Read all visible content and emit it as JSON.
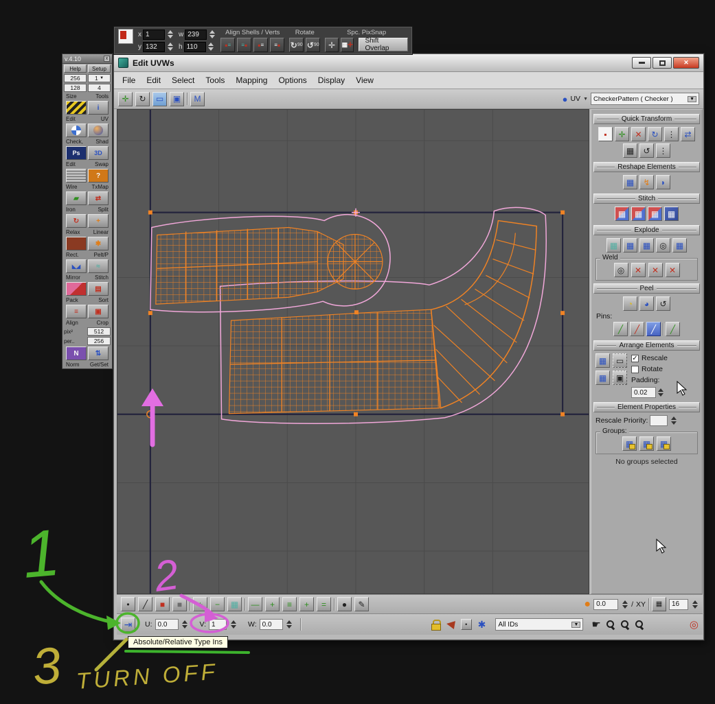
{
  "pixsnap": {
    "x_label": "x",
    "x_value": "1",
    "y_label": "y",
    "y_value": "132",
    "w_label": "w",
    "w_value": "239",
    "h_label": "h",
    "h_value": "110",
    "align_header": "Align Shells / Verts",
    "rotate_header": "Rotate",
    "spc_header": "Spc. PixSnap",
    "shift_overlap": "Shift Overlap",
    "deg": "90"
  },
  "textools": {
    "title": "v.4.10",
    "help": "Help",
    "setup": "Setup",
    "map_size": "256",
    "subdiv": "1",
    "map_size2": "128",
    "subdiv2": "4",
    "size_label": "Size",
    "tools_label": "Tools",
    "pix_label": "pix²",
    "pix_value": "512",
    "per_label": "per..",
    "per_value": "256",
    "caps": [
      "Edit",
      "UV",
      "Check,",
      "Shad",
      "Edit",
      "Swap",
      "Wire",
      "TxMap",
      "Iron",
      "Split",
      "Relax",
      "Linear",
      "Rect.",
      "Pelt/P",
      "Mirror",
      "Stitch",
      "Pack",
      "Sort",
      "Align",
      "Crop",
      "Norm",
      "Get/Set"
    ]
  },
  "window": {
    "title": "Edit UVWs",
    "menus": [
      "File",
      "Edit",
      "Select",
      "Tools",
      "Mapping",
      "Options",
      "Display",
      "View"
    ],
    "uv_label": "UV",
    "pattern": "CheckerPattern  ( Checker )"
  },
  "rightpanel": {
    "sections": [
      "Quick Transform",
      "Reshape Elements",
      "Stitch",
      "Explode",
      "Peel",
      "Arrange Elements",
      "Element Properties"
    ],
    "weld": "Weld",
    "pins": "Pins:",
    "rescale": "Rescale",
    "rotate": "Rotate",
    "rescale_check": "✓",
    "padding": "Padding:",
    "padding_value": "0.02",
    "rescale_priority": "Rescale Priority:",
    "groups": "Groups:",
    "no_groups": "No groups selected"
  },
  "bottom": {
    "u": "U:",
    "u_value": "0.0",
    "v": "V:",
    "v_value": "1",
    "w": "W:",
    "w_value": "0.0",
    "all_ids": "All IDs",
    "angle_value": "0.0",
    "slash": "/",
    "xy": "XY",
    "grid_value": "16"
  },
  "tooltip": {
    "text": "Absolute/Relative Type Ins"
  },
  "annotations": {
    "n1": "1",
    "n2": "2",
    "n3": "3",
    "turn_off": "TURN OFF"
  },
  "icons": {
    "close": "✕",
    "tt_close": "x",
    "drop": "▼",
    "move": "✛",
    "rotate": "↻",
    "marquee": "▭",
    "freeform": "▣",
    "mirror": "M",
    "sphere": "●",
    "dot": "•",
    "edge": "╱",
    "face": "■",
    "element": "■",
    "plus": "+",
    "minus": "−",
    "loop": "▦",
    "dash": "—",
    "lines": "≡",
    "eq": "=",
    "paint": "●",
    "pencil": "✎",
    "swatch": "●",
    "checker": "▦",
    "cross": "✕",
    "vdots": "⋮",
    "arrows": "⇄",
    "pivot": "▪",
    "target": "◎",
    "undo": "↺",
    "pie1": "◔",
    "pie2": "◕",
    "bolt": "↯",
    "half": "◗",
    "pin": "╱",
    "absrel": "⇥",
    "snow": "✱",
    "hand": "☛",
    "info": "i",
    "ps": "Ps",
    "threed": "3D",
    "q": "?",
    "iron": "▰",
    "sort": "▤",
    "wave": "≈",
    "tris": "◣◢",
    "pelt": "✱",
    "crop": "▣",
    "norm": "N",
    "getset": "⇅",
    "grid": "▦"
  }
}
